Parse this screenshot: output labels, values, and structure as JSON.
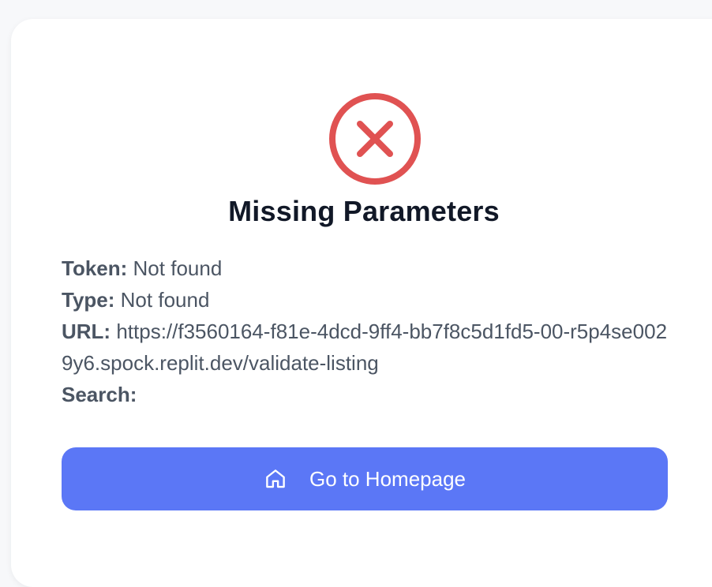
{
  "page": {
    "title": "Missing Parameters",
    "colors": {
      "error_accent": "#e05252",
      "button_bg": "#5b77f6",
      "title_text": "#111827",
      "body_text": "#4b5563"
    }
  },
  "icons": {
    "status": "error-x-circle-icon",
    "button": "home-icon"
  },
  "details": [
    {
      "key": "Token:",
      "value": "Not found"
    },
    {
      "key": "Type:",
      "value": "Not found"
    },
    {
      "key": "URL:",
      "value": "https://f3560164-f81e-4dcd-9ff4-bb7f8c5d1fd5-00-r5p4se0029y6.spock.replit.dev/validate-listing"
    },
    {
      "key": "Search:",
      "value": ""
    }
  ],
  "button": {
    "label": "Go to Homepage"
  }
}
